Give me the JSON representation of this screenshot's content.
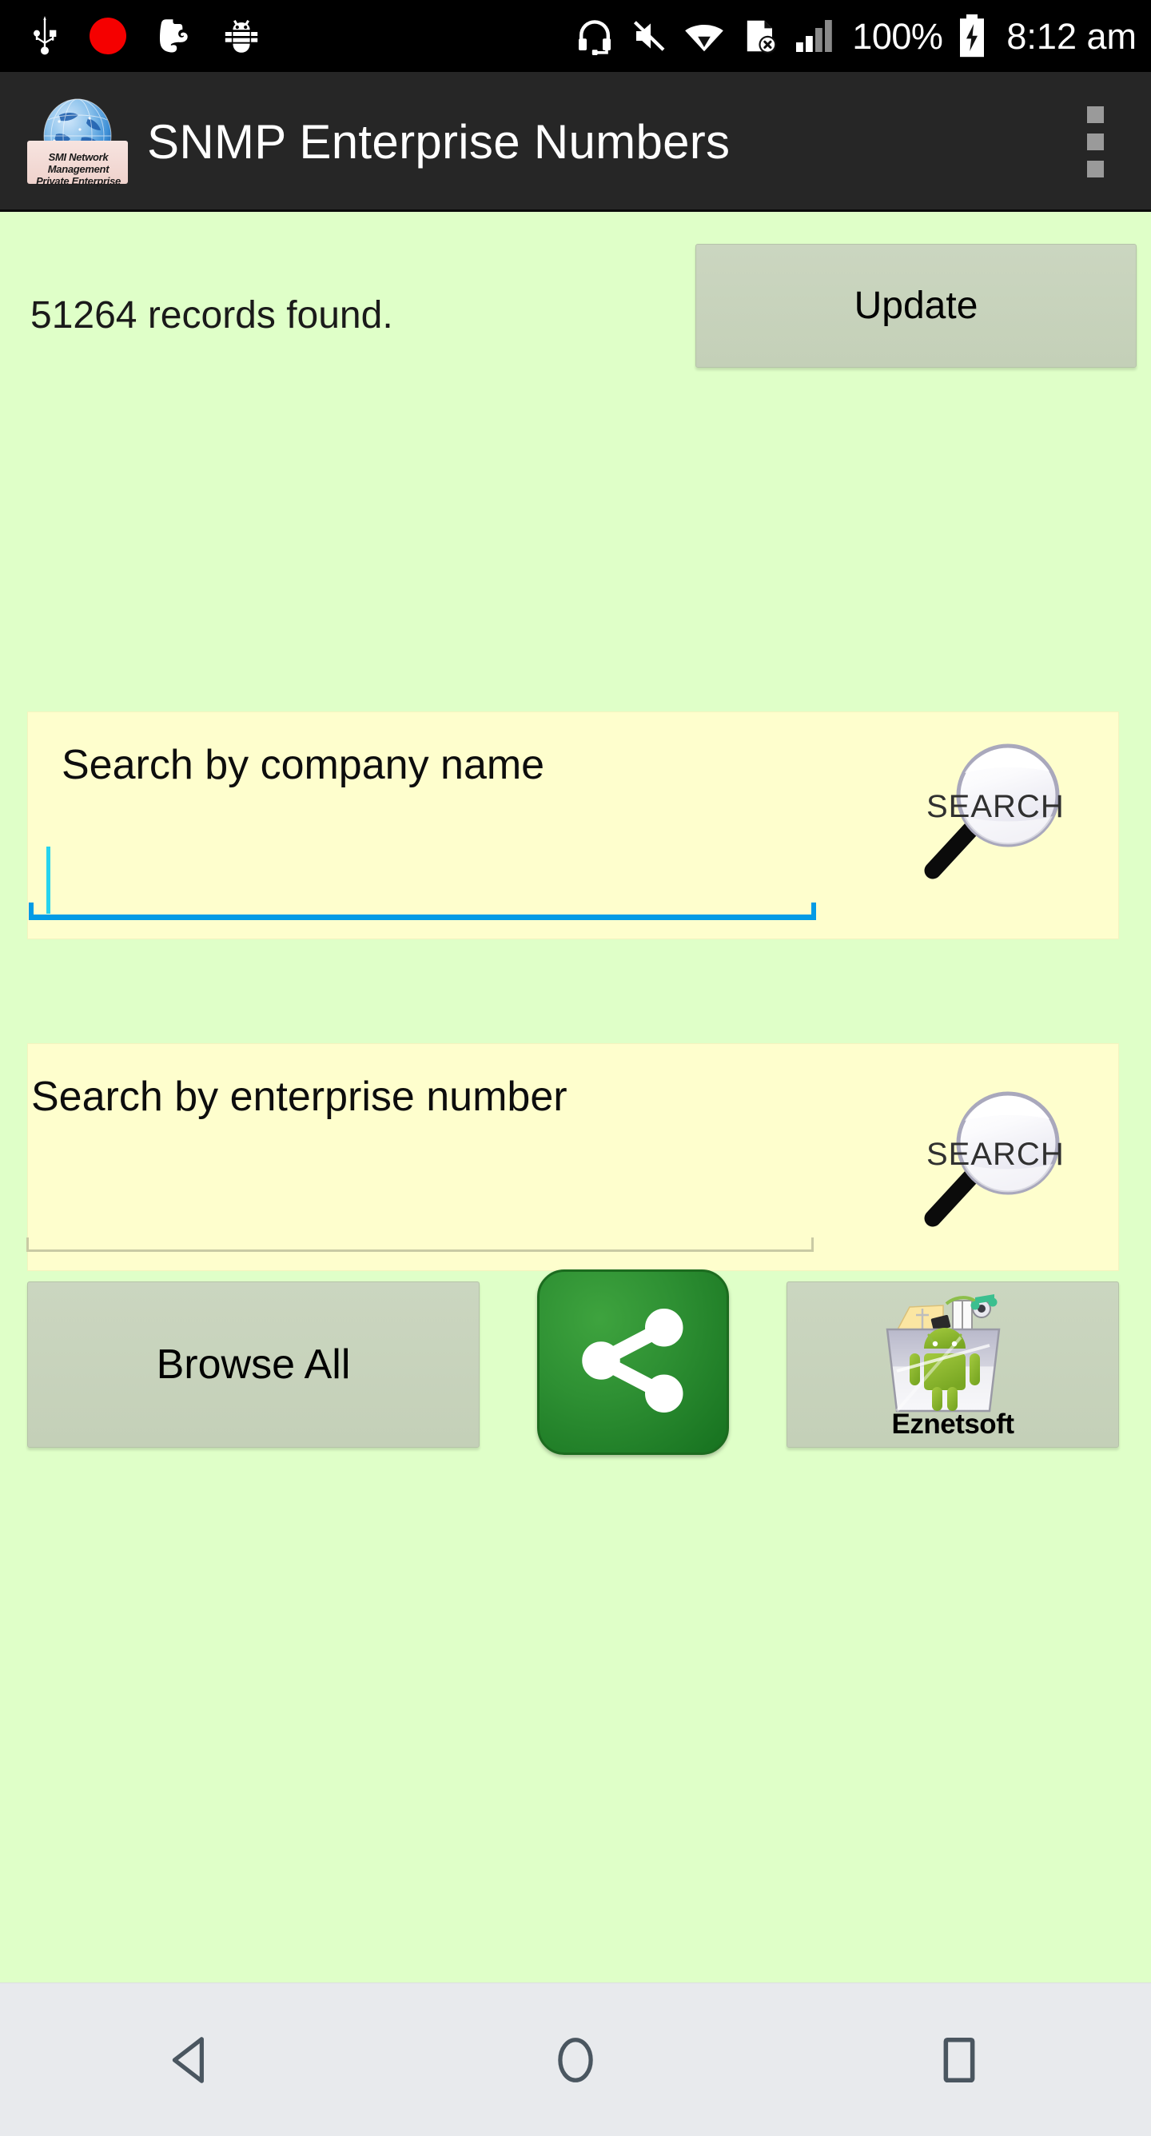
{
  "statusbar": {
    "left_icons": [
      {
        "name": "usb-icon",
        "label": "USB"
      },
      {
        "name": "recording-dot-icon",
        "label": "Recording"
      },
      {
        "name": "evernote-icon",
        "label": "Evernote"
      },
      {
        "name": "android-debug-bug-icon",
        "label": "Debug"
      }
    ],
    "right_icons": [
      {
        "name": "headset-icon",
        "label": "Headset"
      },
      {
        "name": "volume-muted-icon",
        "label": "Muted"
      },
      {
        "name": "wifi-icon",
        "label": "Wi-Fi"
      },
      {
        "name": "no-sim-card-icon",
        "label": "No SIM"
      },
      {
        "name": "cellular-signal-icon",
        "label": "Signal"
      }
    ],
    "battery_percent": "100%",
    "battery_icon": "battery-charging-icon",
    "time": "8:12 am"
  },
  "actionbar": {
    "logo_icon": "app-globe-logo-icon",
    "logo_banner_lines": [
      "SMI Network",
      "Management",
      "Private Enterprise"
    ],
    "title": "SNMP Enterprise Numbers",
    "overflow_icon": "overflow-menu-icon"
  },
  "main": {
    "records_text": "51264 records found.",
    "update_label": "Update",
    "company_search": {
      "label": "Search by company name",
      "value": "",
      "placeholder": "",
      "focused": true,
      "search_icon": "magnifier-search-icon",
      "search_icon_text": "SEARCH"
    },
    "number_search": {
      "label": "Search by enterprise number",
      "value": "",
      "placeholder": "",
      "focused": false,
      "search_icon": "magnifier-search-icon",
      "search_icon_text": "SEARCH"
    },
    "browse_all_label": "Browse All",
    "share_icon": "share-icon",
    "store_icon": "android-app-store-bag-icon",
    "store_label": "Eznetsoft"
  },
  "navbar": {
    "back_icon": "nav-back-icon",
    "home_icon": "nav-home-icon",
    "recents_icon": "nav-recents-icon"
  },
  "colors": {
    "background": "#DFFFC8",
    "card": "#FEFECD",
    "button": "#C7D3BC",
    "accent_focus": "#039BE5",
    "actionbar": "#262626",
    "share_green": "#2E9033",
    "navbar": "#E8EAED"
  }
}
